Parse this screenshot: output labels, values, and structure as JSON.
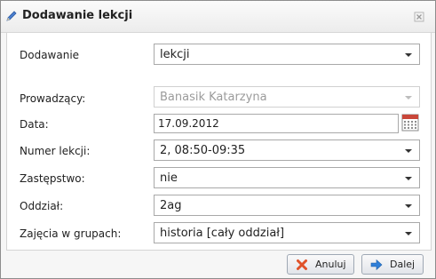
{
  "dialog": {
    "title": "Dodawanie lekcji",
    "title_icon": "pencil-icon",
    "close_icon": "close-icon"
  },
  "form": {
    "mode": {
      "label": "Dodawanie",
      "value": "lekcji"
    },
    "teacher": {
      "label": "Prowadzący:",
      "value": "Banasik Katarzyna"
    },
    "date": {
      "label": "Data:",
      "value": "17.09.2012",
      "icon": "calendar-icon"
    },
    "lesson_number": {
      "label": "Numer lekcji:",
      "value": "2, 08:50-09:35"
    },
    "substitution": {
      "label": "Zastępstwo:",
      "value": "nie"
    },
    "class": {
      "label": "Oddział:",
      "value": "2ag"
    },
    "group_lessons": {
      "label": "Zajęcia w grupach:",
      "value": "historia [cały oddział]"
    }
  },
  "buttons": {
    "cancel": {
      "label": "Anuluj",
      "icon": "cross-icon",
      "icon_color": "#e0522a"
    },
    "next": {
      "label": "Dalej",
      "icon": "arrow-right-icon",
      "icon_color": "#2f7fd8"
    }
  }
}
